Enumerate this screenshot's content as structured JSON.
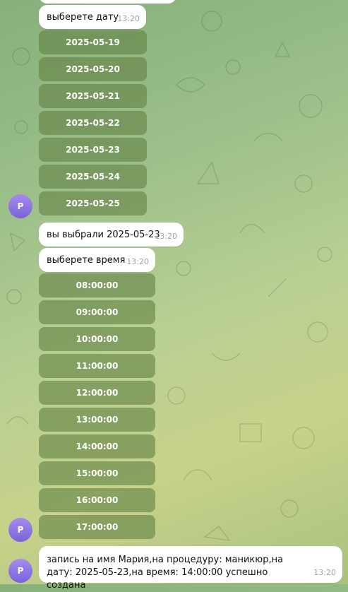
{
  "user": {
    "avatar_initial": "P"
  },
  "messages": {
    "choose_date": {
      "text": "выберете дату",
      "time": "13:20"
    },
    "you_chose": {
      "text": "вы выбрали 2025-05-23",
      "time": "13:20"
    },
    "choose_time": {
      "text": "выберете время",
      "time": "13:20"
    },
    "confirmation": {
      "text": "запись на имя Мария,на процедуру: маникюр,на дату: 2025-05-23,на время: 14:00:00 успешно создана",
      "time": "13:20"
    }
  },
  "date_buttons": [
    "2025-05-19",
    "2025-05-20",
    "2025-05-21",
    "2025-05-22",
    "2025-05-23",
    "2025-05-24",
    "2025-05-25"
  ],
  "time_buttons": [
    "08:00:00",
    "09:00:00",
    "10:00:00",
    "11:00:00",
    "12:00:00",
    "13:00:00",
    "14:00:00",
    "15:00:00",
    "16:00:00",
    "17:00:00"
  ],
  "colors": {
    "bubble": "#ffffff",
    "keyboard_button": "#64824699",
    "avatar": "#8a70e3",
    "timestamp": "#9aa39a"
  }
}
